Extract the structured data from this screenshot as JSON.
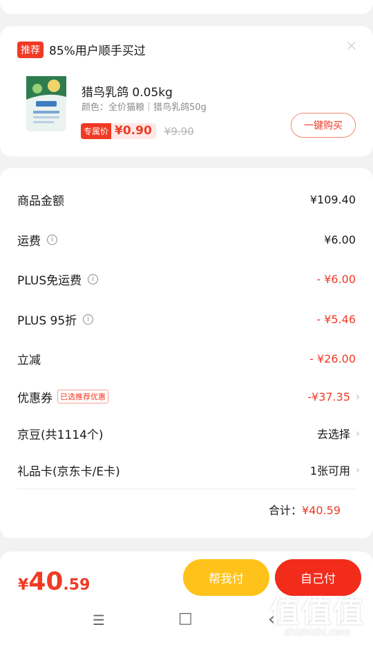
{
  "recommendation": {
    "tag": "推荐",
    "title": "85%用户顺手买过",
    "close": "×",
    "product": {
      "name": "猎鸟乳鸽 0.05kg",
      "spec": "颜色：全价猫粮｜猎鸟乳鸽50g",
      "price_badge": "专属价",
      "price": "¥0.90",
      "original_price": "¥9.90",
      "buy_button": "一键购买"
    }
  },
  "summary": {
    "rows": [
      {
        "label": "商品金额",
        "value": "¥109.40"
      },
      {
        "label": "运费",
        "value": "¥6.00"
      },
      {
        "label": "PLUS免运费",
        "value": "- ¥6.00"
      },
      {
        "label": "PLUS 95折",
        "value": "- ¥5.46"
      },
      {
        "label": "立减",
        "value": "- ¥26.00"
      },
      {
        "label": "优惠券",
        "tag": "已选推荐优惠",
        "value": "-¥37.35"
      },
      {
        "label": "京豆(共1114个)",
        "value": "去选择"
      },
      {
        "label": "礼品卡(京东卡/E卡)",
        "value": "1张可用"
      }
    ],
    "total_label": "合计：",
    "total_value": "¥40.59"
  },
  "bottom": {
    "price_currency": "¥",
    "price_int": "40",
    "price_dec": ".59",
    "help_pay": "帮我付",
    "self_pay": "自己付"
  },
  "navbar": {
    "menu": "☰",
    "home": "□",
    "back": "‹"
  },
  "watermark": {
    "big": "值值值",
    "small": "zhizhizhi.com"
  },
  "colors": {
    "accent_red": "#f03a24",
    "pay_yellow": "#ffc21a",
    "pay_red": "#f22c1b"
  }
}
